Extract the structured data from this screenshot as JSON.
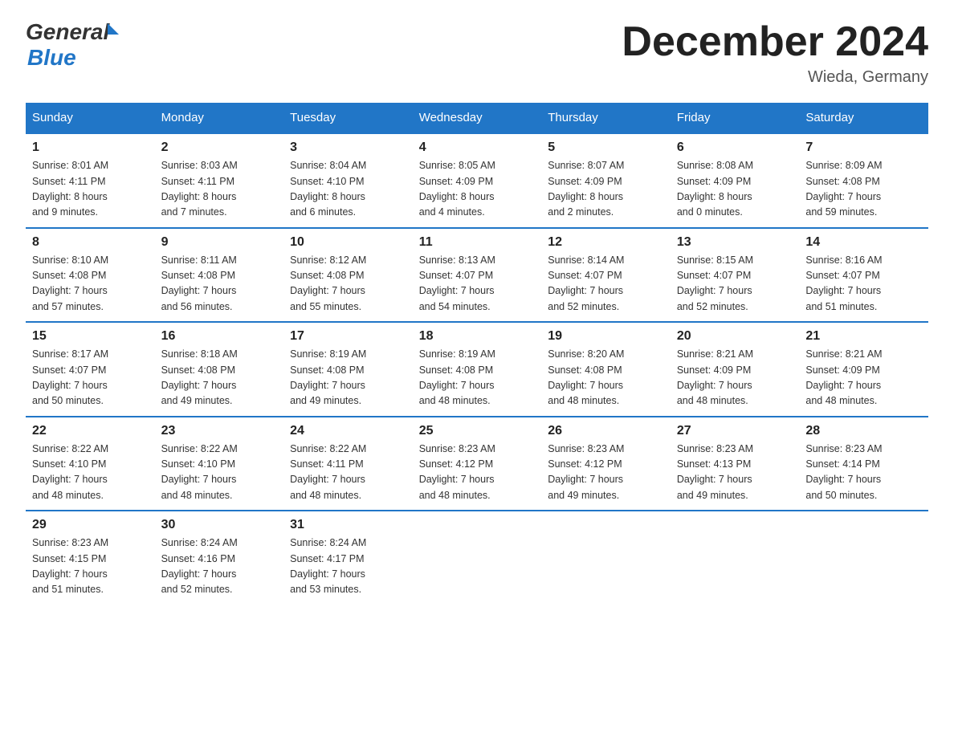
{
  "logo": {
    "general": "General",
    "blue": "Blue"
  },
  "header": {
    "title": "December 2024",
    "location": "Wieda, Germany"
  },
  "weekdays": [
    "Sunday",
    "Monday",
    "Tuesday",
    "Wednesday",
    "Thursday",
    "Friday",
    "Saturday"
  ],
  "weeks": [
    [
      {
        "day": "1",
        "sunrise": "8:01 AM",
        "sunset": "4:11 PM",
        "daylight": "8 hours and 9 minutes."
      },
      {
        "day": "2",
        "sunrise": "8:03 AM",
        "sunset": "4:11 PM",
        "daylight": "8 hours and 7 minutes."
      },
      {
        "day": "3",
        "sunrise": "8:04 AM",
        "sunset": "4:10 PM",
        "daylight": "8 hours and 6 minutes."
      },
      {
        "day": "4",
        "sunrise": "8:05 AM",
        "sunset": "4:09 PM",
        "daylight": "8 hours and 4 minutes."
      },
      {
        "day": "5",
        "sunrise": "8:07 AM",
        "sunset": "4:09 PM",
        "daylight": "8 hours and 2 minutes."
      },
      {
        "day": "6",
        "sunrise": "8:08 AM",
        "sunset": "4:09 PM",
        "daylight": "8 hours and 0 minutes."
      },
      {
        "day": "7",
        "sunrise": "8:09 AM",
        "sunset": "4:08 PM",
        "daylight": "7 hours and 59 minutes."
      }
    ],
    [
      {
        "day": "8",
        "sunrise": "8:10 AM",
        "sunset": "4:08 PM",
        "daylight": "7 hours and 57 minutes."
      },
      {
        "day": "9",
        "sunrise": "8:11 AM",
        "sunset": "4:08 PM",
        "daylight": "7 hours and 56 minutes."
      },
      {
        "day": "10",
        "sunrise": "8:12 AM",
        "sunset": "4:08 PM",
        "daylight": "7 hours and 55 minutes."
      },
      {
        "day": "11",
        "sunrise": "8:13 AM",
        "sunset": "4:07 PM",
        "daylight": "7 hours and 54 minutes."
      },
      {
        "day": "12",
        "sunrise": "8:14 AM",
        "sunset": "4:07 PM",
        "daylight": "7 hours and 52 minutes."
      },
      {
        "day": "13",
        "sunrise": "8:15 AM",
        "sunset": "4:07 PM",
        "daylight": "7 hours and 52 minutes."
      },
      {
        "day": "14",
        "sunrise": "8:16 AM",
        "sunset": "4:07 PM",
        "daylight": "7 hours and 51 minutes."
      }
    ],
    [
      {
        "day": "15",
        "sunrise": "8:17 AM",
        "sunset": "4:07 PM",
        "daylight": "7 hours and 50 minutes."
      },
      {
        "day": "16",
        "sunrise": "8:18 AM",
        "sunset": "4:08 PM",
        "daylight": "7 hours and 49 minutes."
      },
      {
        "day": "17",
        "sunrise": "8:19 AM",
        "sunset": "4:08 PM",
        "daylight": "7 hours and 49 minutes."
      },
      {
        "day": "18",
        "sunrise": "8:19 AM",
        "sunset": "4:08 PM",
        "daylight": "7 hours and 48 minutes."
      },
      {
        "day": "19",
        "sunrise": "8:20 AM",
        "sunset": "4:08 PM",
        "daylight": "7 hours and 48 minutes."
      },
      {
        "day": "20",
        "sunrise": "8:21 AM",
        "sunset": "4:09 PM",
        "daylight": "7 hours and 48 minutes."
      },
      {
        "day": "21",
        "sunrise": "8:21 AM",
        "sunset": "4:09 PM",
        "daylight": "7 hours and 48 minutes."
      }
    ],
    [
      {
        "day": "22",
        "sunrise": "8:22 AM",
        "sunset": "4:10 PM",
        "daylight": "7 hours and 48 minutes."
      },
      {
        "day": "23",
        "sunrise": "8:22 AM",
        "sunset": "4:10 PM",
        "daylight": "7 hours and 48 minutes."
      },
      {
        "day": "24",
        "sunrise": "8:22 AM",
        "sunset": "4:11 PM",
        "daylight": "7 hours and 48 minutes."
      },
      {
        "day": "25",
        "sunrise": "8:23 AM",
        "sunset": "4:12 PM",
        "daylight": "7 hours and 48 minutes."
      },
      {
        "day": "26",
        "sunrise": "8:23 AM",
        "sunset": "4:12 PM",
        "daylight": "7 hours and 49 minutes."
      },
      {
        "day": "27",
        "sunrise": "8:23 AM",
        "sunset": "4:13 PM",
        "daylight": "7 hours and 49 minutes."
      },
      {
        "day": "28",
        "sunrise": "8:23 AM",
        "sunset": "4:14 PM",
        "daylight": "7 hours and 50 minutes."
      }
    ],
    [
      {
        "day": "29",
        "sunrise": "8:23 AM",
        "sunset": "4:15 PM",
        "daylight": "7 hours and 51 minutes."
      },
      {
        "day": "30",
        "sunrise": "8:24 AM",
        "sunset": "4:16 PM",
        "daylight": "7 hours and 52 minutes."
      },
      {
        "day": "31",
        "sunrise": "8:24 AM",
        "sunset": "4:17 PM",
        "daylight": "7 hours and 53 minutes."
      },
      null,
      null,
      null,
      null
    ]
  ],
  "labels": {
    "sunrise": "Sunrise:",
    "sunset": "Sunset:",
    "daylight": "Daylight:"
  }
}
